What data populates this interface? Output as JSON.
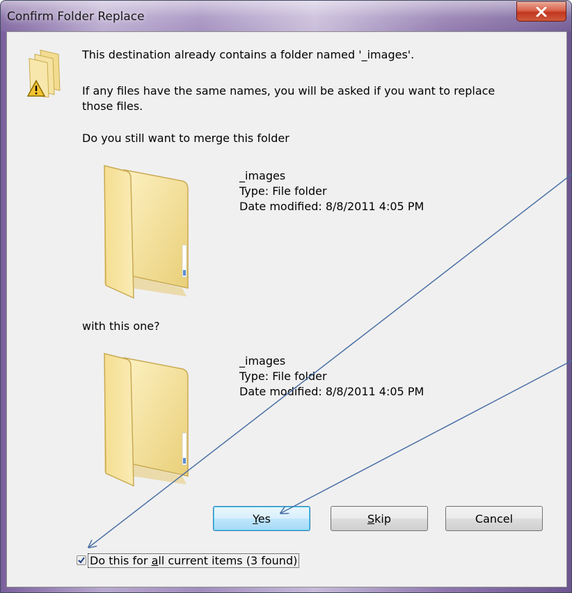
{
  "window": {
    "title": "Confirm Folder Replace",
    "close_glyph": "X"
  },
  "message": {
    "line1": "This destination already contains a folder named '_images'.",
    "line2a": "If any files have the same names, you will be asked if you want to replace",
    "line2b": "those files.",
    "prompt": "Do you still want to merge this folder",
    "with_this": "with this one?"
  },
  "source_folder": {
    "name": "_images",
    "type": "Type: File folder",
    "modified": "Date modified: 8/8/2011 4:05 PM"
  },
  "dest_folder": {
    "name": "_images",
    "type": "Type: File folder",
    "modified": "Date modified: 8/8/2011 4:05 PM"
  },
  "buttons": {
    "yes_rest": "es",
    "yes_mnemonic": "Y",
    "skip_mnemonic": "S",
    "skip_rest": "kip",
    "cancel": "Cancel"
  },
  "checkbox": {
    "checked": true,
    "label_pre": "Do this for ",
    "label_mnemonic": "a",
    "label_post": "ll current items (3 found)"
  },
  "icons": [
    "warning-folder-icon",
    "folder-icon",
    "folder-icon",
    "close-icon",
    "check-icon"
  ],
  "colors": {
    "annotation_arrow": "#4a6fa5",
    "dialog_bg": "#f0f0f0",
    "close_button": "#c2361f"
  }
}
